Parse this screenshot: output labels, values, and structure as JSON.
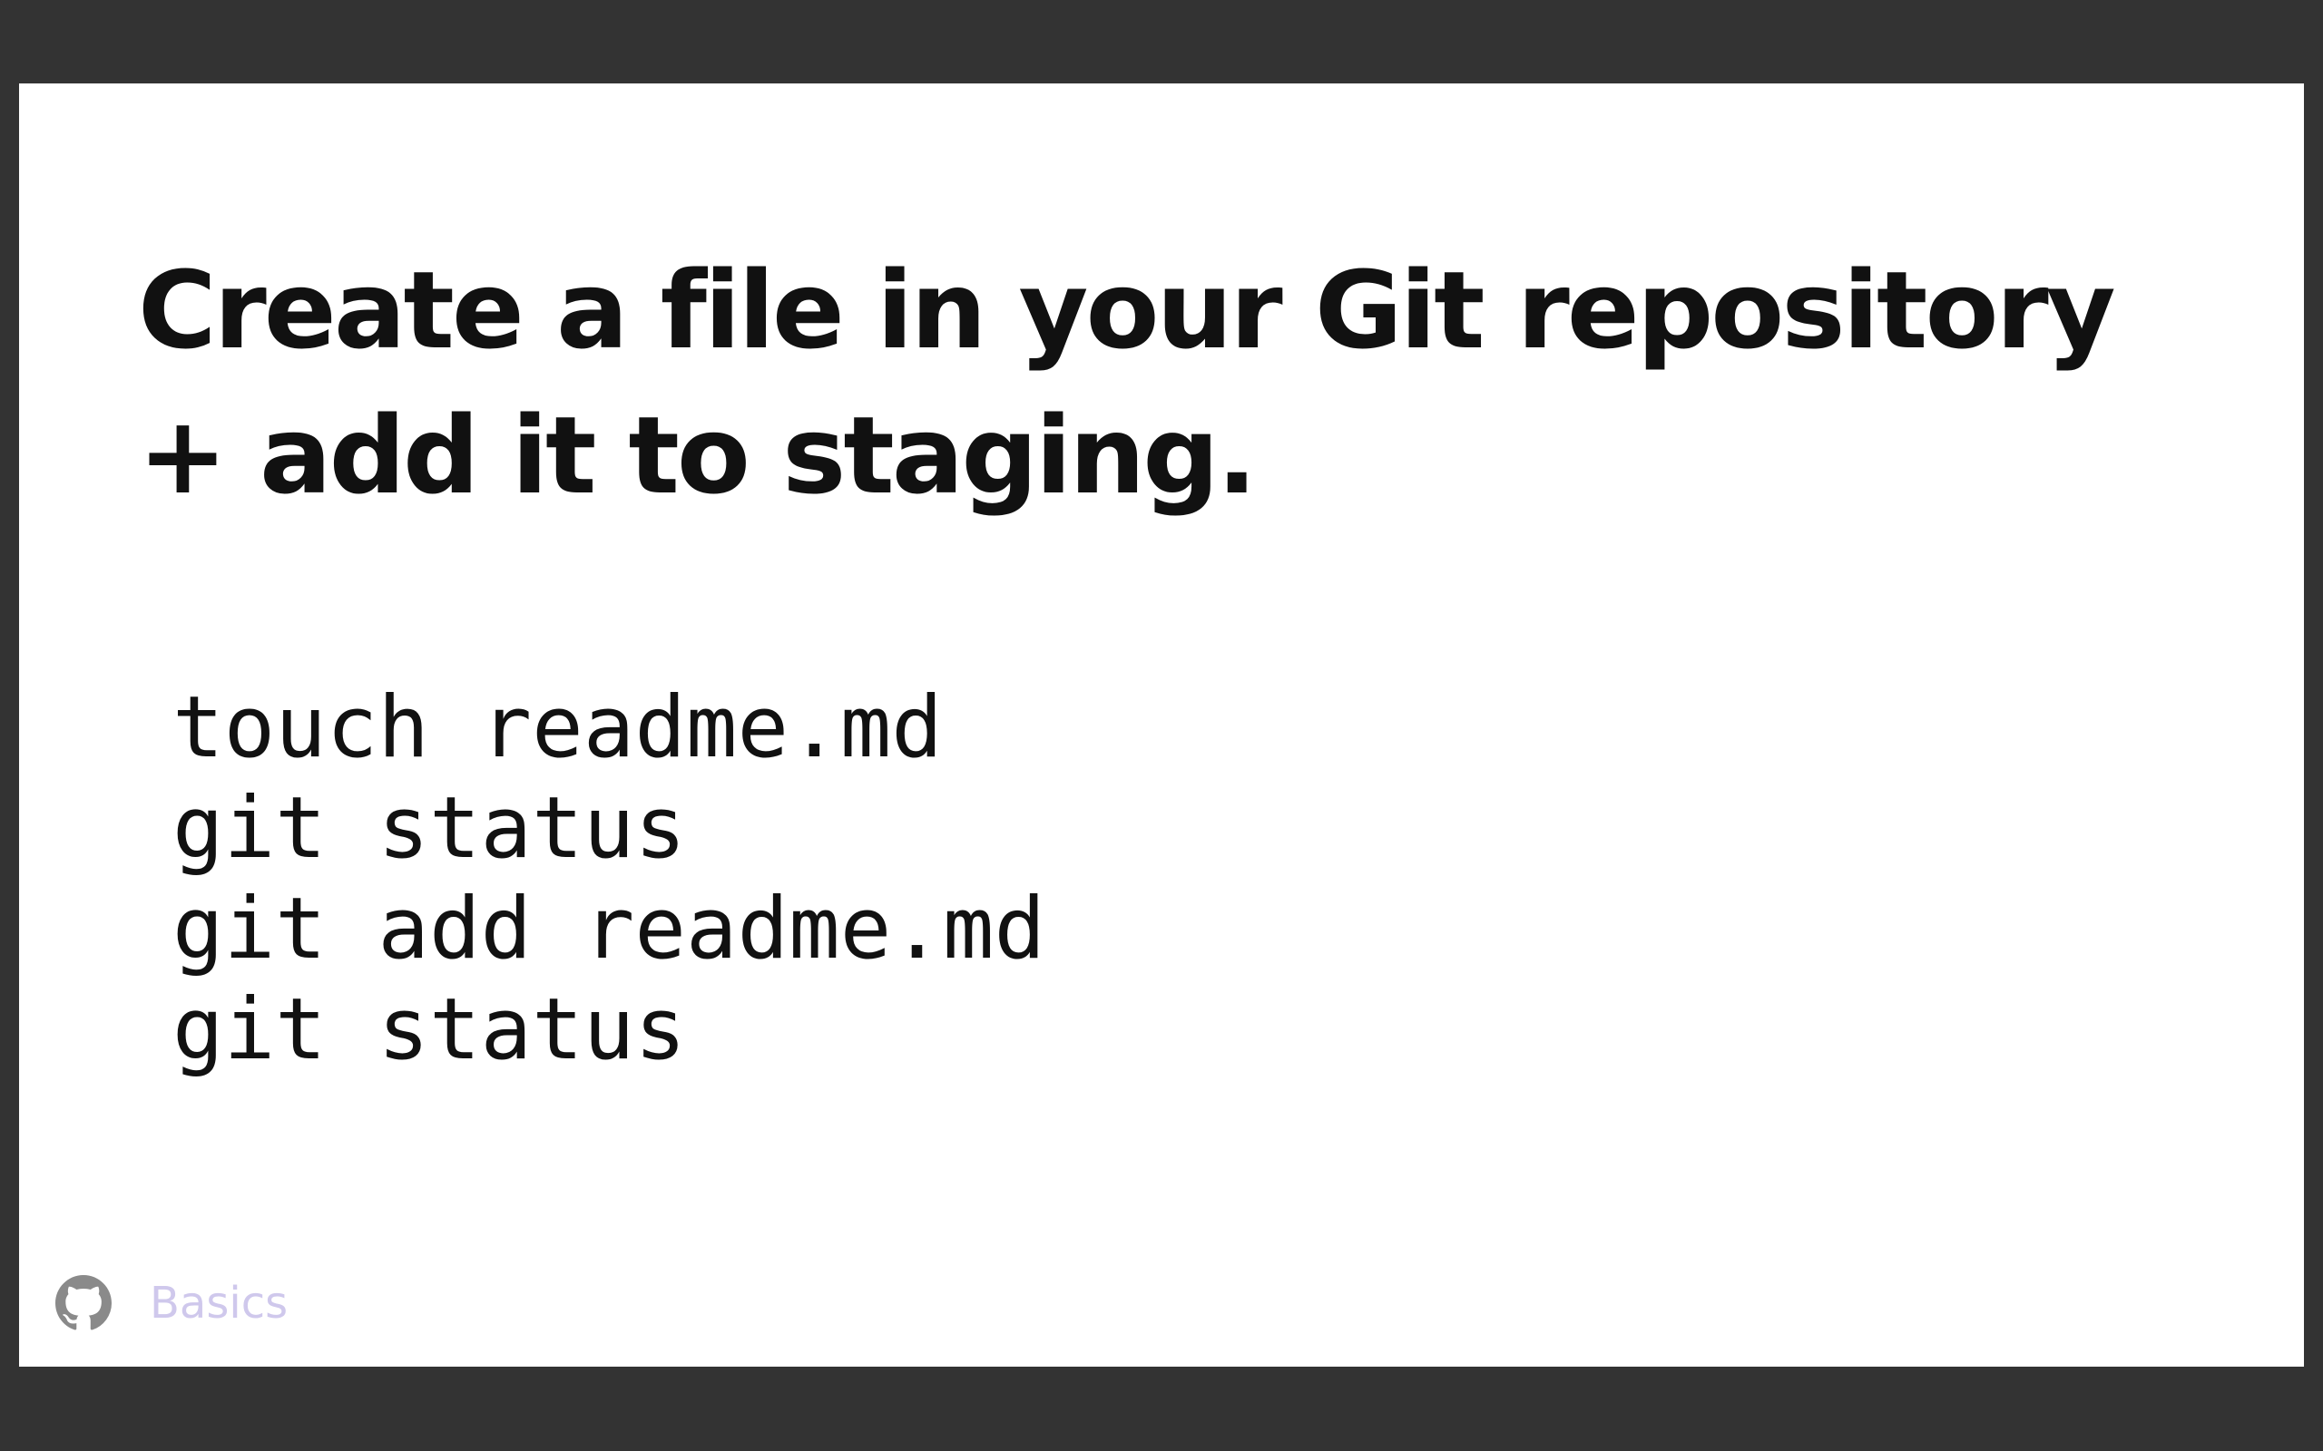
{
  "slide": {
    "title": "Create a file in your Git repository + add it to staging.",
    "code_lines": [
      "touch readme.md",
      "git status",
      "git add readme.md",
      "git status"
    ]
  },
  "footer": {
    "icon": "github-icon",
    "label": "Basics",
    "label_color": "#cfc8ec"
  },
  "colors": {
    "frame_background": "#333333",
    "slide_background": "#ffffff",
    "text": "#111111"
  }
}
